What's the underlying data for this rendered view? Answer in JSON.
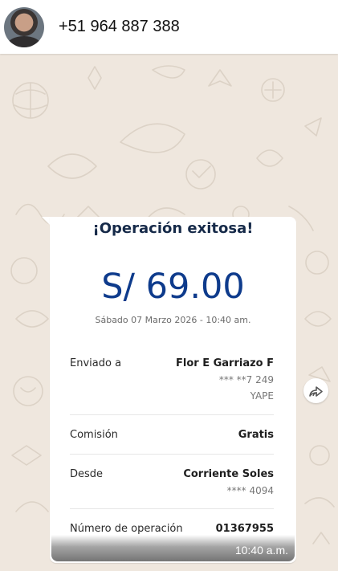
{
  "header": {
    "contact": "+51 964 887 388"
  },
  "receipt": {
    "title": "¡Operación exitosa!",
    "amount": "S/ 69.00",
    "date": "Sábado 07 Marzo 2026 - 10:40 am.",
    "rows": [
      {
        "label": "Enviado a",
        "value": "Flor E Garriazo F",
        "sub1": "*** **7 249",
        "sub2": "YAPE"
      },
      {
        "label": "Comisión",
        "value": "Gratis"
      },
      {
        "label": "Desde",
        "value": "Corriente Soles",
        "sub1": "**** 4094"
      },
      {
        "label": "Número de operación",
        "value": "01367955"
      }
    ]
  },
  "message": {
    "time": "10:40 a.m."
  },
  "icons": {
    "forward": "forward-arrow-icon",
    "avatar": "contact-avatar"
  },
  "colors": {
    "chat_background": "#efe7de",
    "amount_blue": "#0e3b8c",
    "title_navy": "#162a49"
  }
}
